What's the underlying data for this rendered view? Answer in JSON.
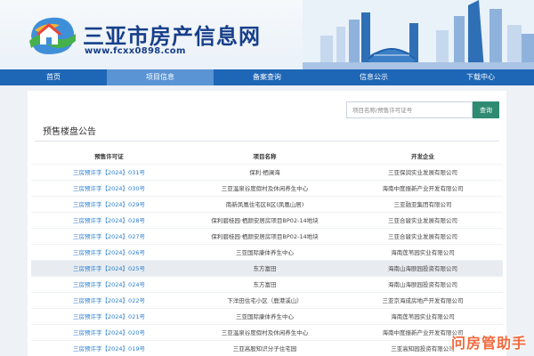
{
  "site": {
    "title": "三亚市房产信息网",
    "url": "www.fcxx0898.com"
  },
  "nav": {
    "items": [
      {
        "label": "首页"
      },
      {
        "label": "项目信息",
        "active": true
      },
      {
        "label": "备案查询"
      },
      {
        "label": "信息公示"
      },
      {
        "label": "下载中心"
      }
    ]
  },
  "search": {
    "placeholder": "项目名称/预售许可证号",
    "value": "",
    "button_label": "查询"
  },
  "section": {
    "title": "预售楼盘公告"
  },
  "table": {
    "headers": [
      "预售许可证",
      "项目名称",
      "开发企业"
    ],
    "rows": [
      {
        "permit": "三房预许字【2024】031号",
        "project": "保利·栖澜海",
        "developer": "三亚保润实业发展有限公司"
      },
      {
        "permit": "三房预许字【2024】030号",
        "project": "三亚温泉谷度假村及休闲养生中心",
        "developer": "海南中度振新产业开发有限公司"
      },
      {
        "permit": "三房预许字【2024】029号",
        "project": "南新凤凰住宅区B区(凤凰山居)",
        "developer": "三亚融亚集团有限公司"
      },
      {
        "permit": "三房预许字【2024】028号",
        "project": "保利碧桂园·栖颜安居房项目BP02-14地块",
        "developer": "三亚合骏实业发展有限公司"
      },
      {
        "permit": "三房预许字【2024】027号",
        "project": "保利碧桂园·栖颜安居房项目BP02-14地块",
        "developer": "三亚合骏实业发展有限公司"
      },
      {
        "permit": "三房预许字【2024】026号",
        "project": "三亚国际康体养生中心",
        "developer": "海南莲苇园实业有限公司"
      },
      {
        "permit": "三房预许字【2024】025号",
        "project": "东方富田",
        "developer": "海南山海颐园投资有限公司",
        "highlight": true
      },
      {
        "permit": "三房预许字【2024】024号",
        "project": "东方富田",
        "developer": "海南山海颐园投资有限公司"
      },
      {
        "permit": "三房预许字【2024】022号",
        "project": "下洋田住宅小区（鹿港溪山）",
        "developer": "三亚京海成房地产开发有限公司"
      },
      {
        "permit": "三房预许字【2024】021号",
        "project": "三亚国际康体养生中心",
        "developer": "海南莲苇园实业有限公司"
      },
      {
        "permit": "三房预许字【2024】020号",
        "project": "三亚温泉谷度假村及休闲养生中心",
        "developer": "海南中度振新产业开发有限公司"
      },
      {
        "permit": "三房预许字【2024】019号",
        "project": "三亚高股知识分子住宅园",
        "developer": "三亚高知园投资有限公司"
      }
    ]
  },
  "watermark": {
    "text": "问房管助手"
  },
  "colors": {
    "nav": "#1e66b6",
    "nav_active": "#5a94d4",
    "brand": "#173f8a",
    "link": "#2a7fd0",
    "search_button": "#2e8b72"
  }
}
